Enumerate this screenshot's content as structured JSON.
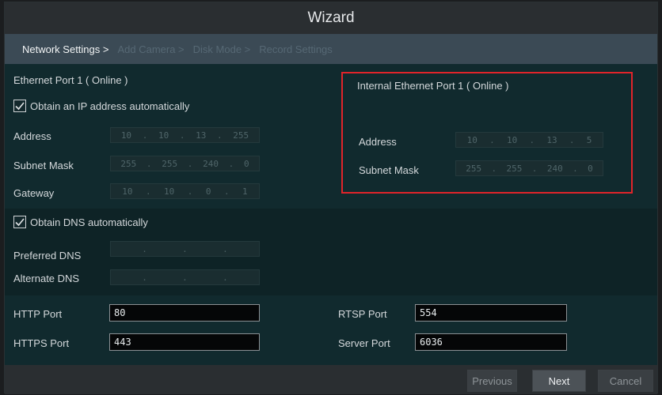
{
  "window": {
    "title": "Wizard"
  },
  "steps": [
    {
      "label": "Network Settings >",
      "active": true
    },
    {
      "label": "Add Camera >",
      "active": false
    },
    {
      "label": "Disk Mode >",
      "active": false
    },
    {
      "label": "Record Settings",
      "active": false
    }
  ],
  "ethernet": {
    "port_title": "Ethernet Port 1 ( Online )",
    "obtain_ip_label": "Obtain an IP address automatically",
    "obtain_ip_checked": true,
    "address_label": "Address",
    "address": [
      "10",
      "10",
      "13",
      "255"
    ],
    "subnet_label": "Subnet Mask",
    "subnet": [
      "255",
      "255",
      "240",
      "0"
    ],
    "gateway_label": "Gateway",
    "gateway": [
      "10",
      "10",
      "0",
      "1"
    ]
  },
  "internal": {
    "port_title": "Internal Ethernet Port 1 ( Online )",
    "address_label": "Address",
    "address": [
      "10",
      "10",
      "13",
      "5"
    ],
    "subnet_label": "Subnet Mask",
    "subnet": [
      "255",
      "255",
      "240",
      "0"
    ]
  },
  "dns": {
    "obtain_dns_label": "Obtain DNS automatically",
    "obtain_dns_checked": true,
    "preferred_label": "Preferred DNS",
    "preferred": [
      "",
      "",
      "",
      ""
    ],
    "alternate_label": "Alternate DNS",
    "alternate": [
      "",
      "",
      "",
      ""
    ]
  },
  "ports": {
    "http_label": "HTTP Port",
    "http_value": "80",
    "https_label": "HTTPS Port",
    "https_value": "443",
    "rtsp_label": "RTSP Port",
    "rtsp_value": "554",
    "server_label": "Server Port",
    "server_value": "6036"
  },
  "footer": {
    "previous_label": "Previous",
    "next_label": "Next",
    "cancel_label": "Cancel"
  },
  "colors": {
    "highlight_box": "#e0242a",
    "step_active": "#f2f4f5",
    "step_inactive": "#566874"
  }
}
